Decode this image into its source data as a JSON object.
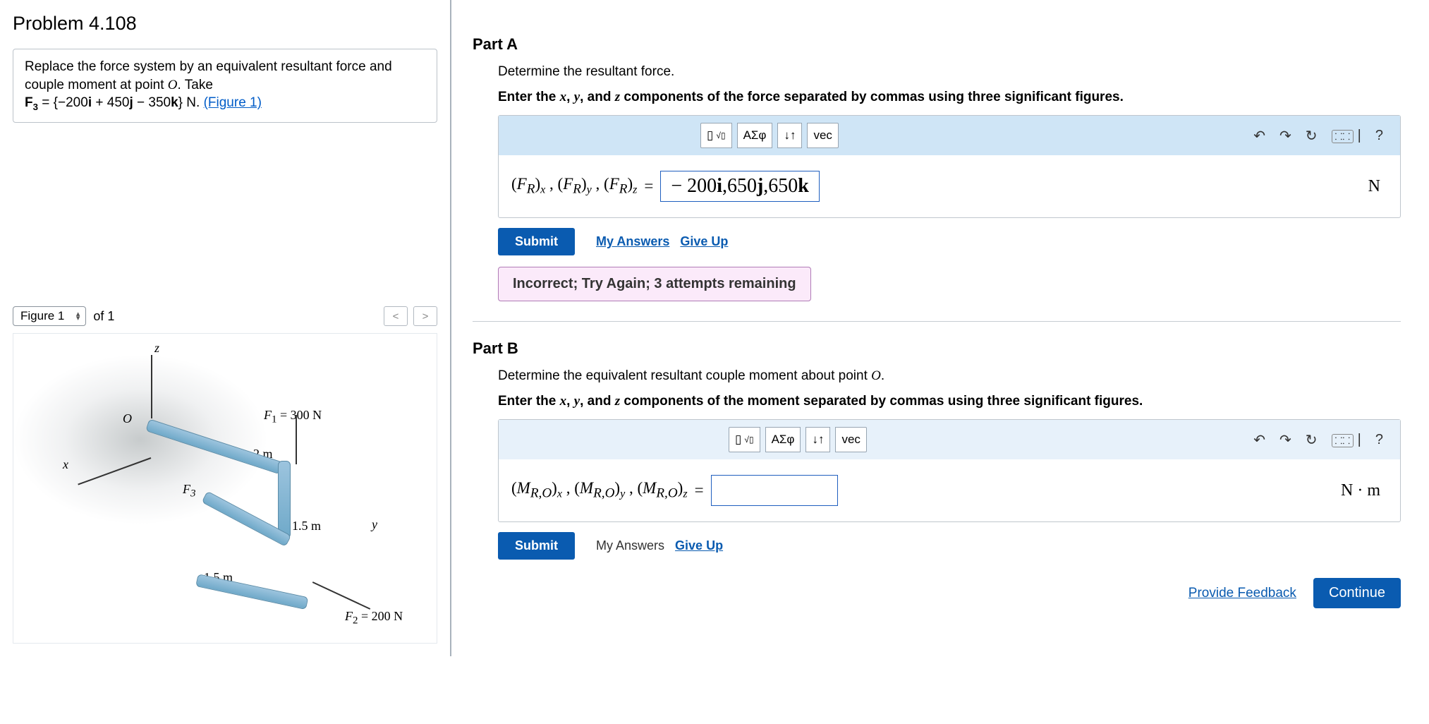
{
  "problem": {
    "title": "Problem 4.108",
    "desc_prefix": "Replace the force system by an equivalent resultant force and couple moment at point ",
    "desc_point": "O",
    "desc_take": ". Take",
    "f3_label": "F",
    "f3_sub": "3",
    "f3_eq": " = {−200i + 450j − 350k} N. ",
    "fig_link": "(Figure 1)"
  },
  "figure": {
    "select": "Figure 1",
    "of": "of 1",
    "prev": "<",
    "next": ">",
    "labels": {
      "z": "z",
      "x": "x",
      "y": "y",
      "O": "O",
      "F1": "F₁ = 300 N",
      "F2": "F₂ = 200 N",
      "F3": "F₃",
      "d2m": "2 m",
      "d15a": "1.5 m",
      "d15b": "1.5 m"
    }
  },
  "partA": {
    "header": "Part A",
    "line1": "Determine the resultant force.",
    "line2a": "Enter the ",
    "line2b": ", and ",
    "line2c": " components of the force separated by commas using three significant figures.",
    "lhs": "(F_R)_x , (F_R)_y , (F_R)_z",
    "value": "− 200i,650 j ,650k",
    "unit": "N",
    "submit": "Submit",
    "my": "My Answers",
    "give": "Give Up",
    "feedback": "Incorrect; Try Again; 3 attempts remaining"
  },
  "partB": {
    "header": "Part B",
    "line1": "Determine the equivalent resultant couple moment about point O.",
    "line2a": "Enter the ",
    "line2b": ", and ",
    "line2c": " components of the moment separated by commas using three significant figures.",
    "unit": "N · m",
    "submit": "Submit",
    "my": "My Answers",
    "give": "Give Up"
  },
  "toolbar": {
    "templates": "▢√▢",
    "greek": "ΑΣφ",
    "vec_arrow": "↓↑",
    "vec": "vec",
    "undo": "↶",
    "redo": "↷",
    "reset": "↻",
    "kbd": "⌨",
    "help": "?"
  },
  "footer": {
    "provide": "Provide Feedback",
    "cont": "Continue"
  }
}
